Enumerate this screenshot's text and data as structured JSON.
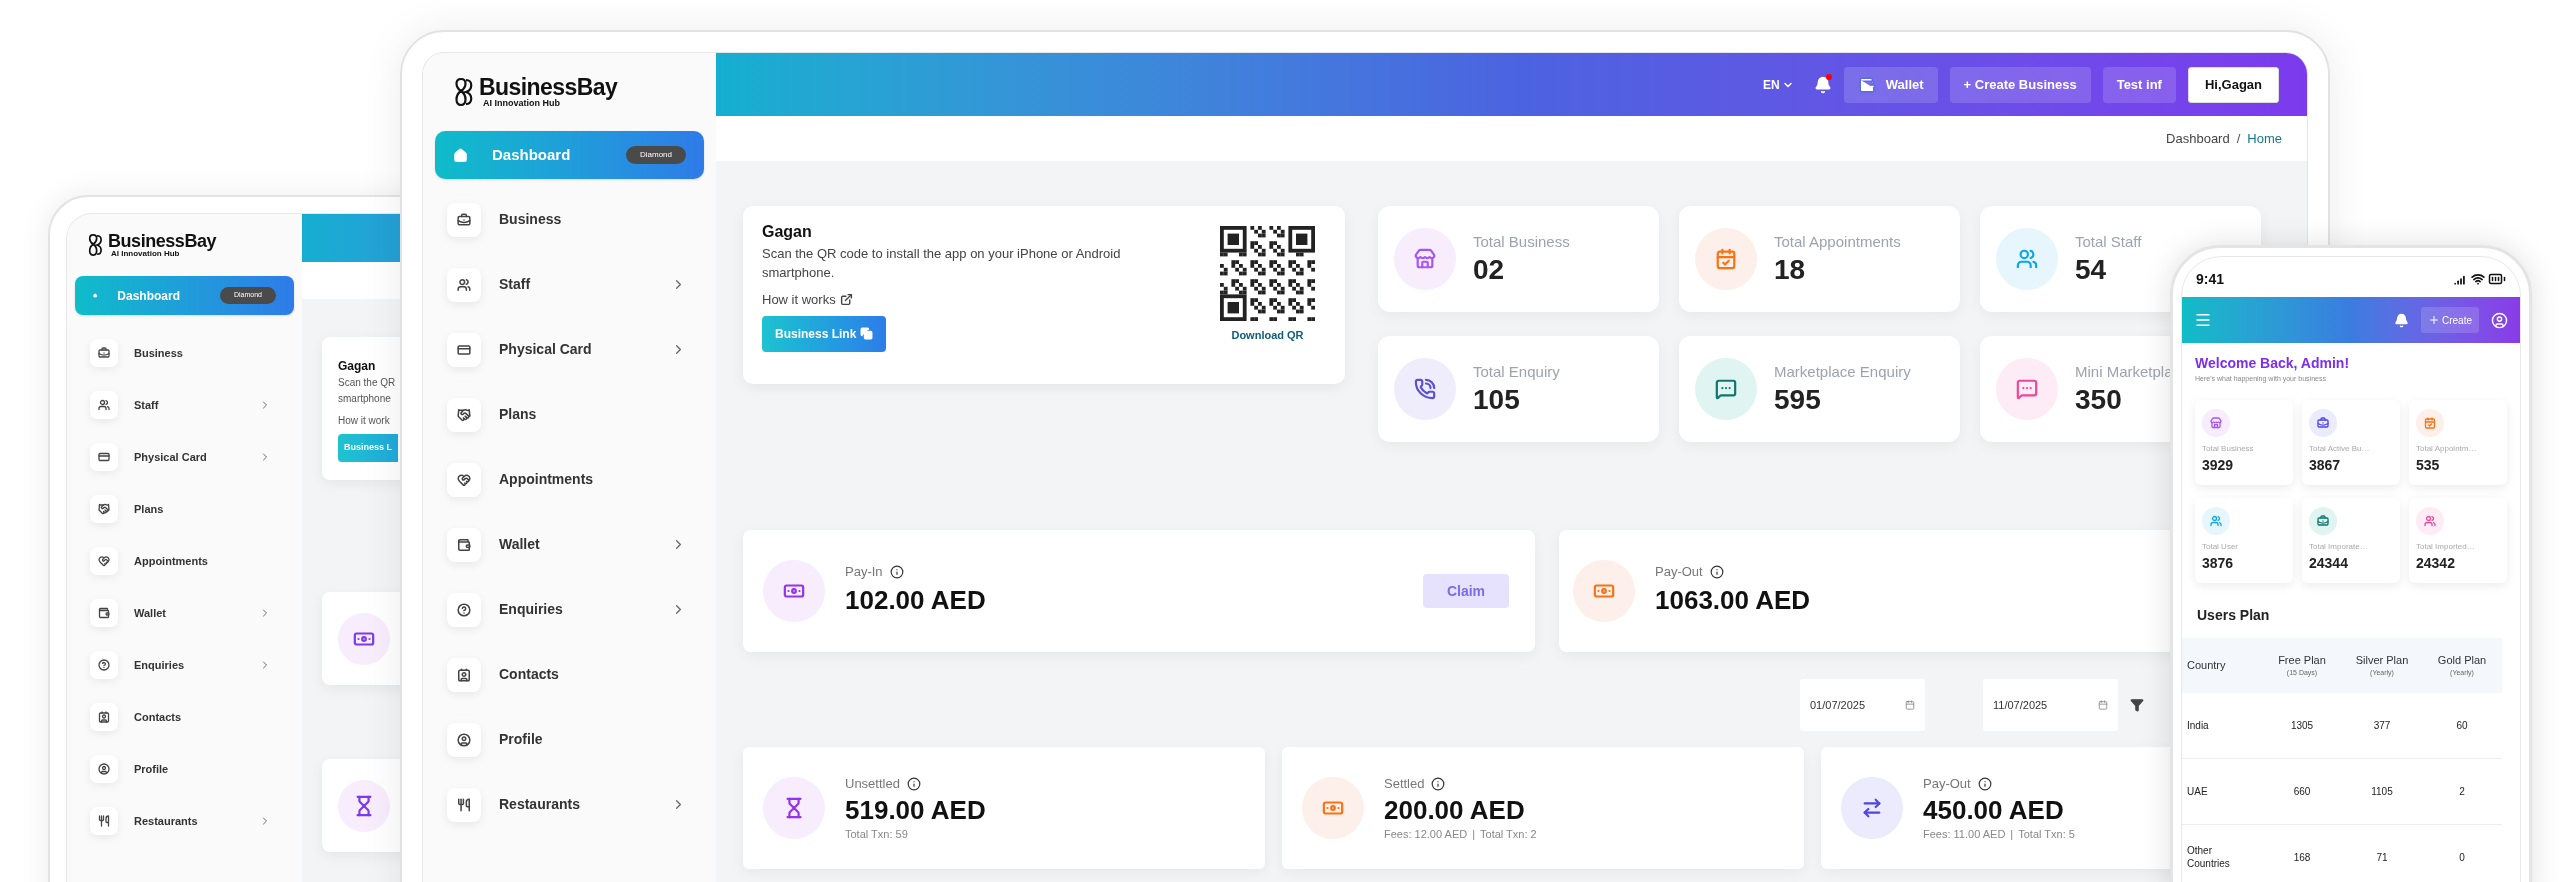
{
  "tablet": {
    "logo": {
      "name": "BusinessBay",
      "tagline": "AI Innovation Hub"
    },
    "nav": [
      {
        "label": "Dashboard",
        "badge": "Diamond",
        "selected": true,
        "submenu": false
      },
      {
        "label": "Business",
        "selected": false,
        "submenu": false
      },
      {
        "label": "Staff",
        "selected": false,
        "submenu": true
      },
      {
        "label": "Physical Card",
        "selected": false,
        "submenu": true
      },
      {
        "label": "Plans",
        "selected": false,
        "submenu": false
      },
      {
        "label": "Appointments",
        "selected": false,
        "submenu": false
      },
      {
        "label": "Wallet",
        "selected": false,
        "submenu": true
      },
      {
        "label": "Enquiries",
        "selected": false,
        "submenu": true
      },
      {
        "label": "Contacts",
        "selected": false,
        "submenu": false
      },
      {
        "label": "Profile",
        "selected": false,
        "submenu": false
      },
      {
        "label": "Restaurants",
        "selected": false,
        "submenu": true
      }
    ],
    "qr_card": {
      "name": "Gagan",
      "description_lines": [
        "Scan the QR",
        "smartphone"
      ],
      "how_it_works": "How it work",
      "button": "Business L"
    }
  },
  "main": {
    "logo": {
      "name": "BusinessBay",
      "tagline": "AI Innovation Hub"
    },
    "nav": [
      {
        "label": "Dashboard",
        "badge": "Diamond",
        "selected": true,
        "submenu": false
      },
      {
        "label": "Business",
        "selected": false,
        "submenu": false
      },
      {
        "label": "Staff",
        "selected": false,
        "submenu": true
      },
      {
        "label": "Physical Card",
        "selected": false,
        "submenu": true
      },
      {
        "label": "Plans",
        "selected": false,
        "submenu": false
      },
      {
        "label": "Appointments",
        "selected": false,
        "submenu": false
      },
      {
        "label": "Wallet",
        "selected": false,
        "submenu": true
      },
      {
        "label": "Enquiries",
        "selected": false,
        "submenu": true
      },
      {
        "label": "Contacts",
        "selected": false,
        "submenu": false
      },
      {
        "label": "Profile",
        "selected": false,
        "submenu": false
      },
      {
        "label": "Restaurants",
        "selected": false,
        "submenu": true
      }
    ],
    "header": {
      "language": "EN",
      "notifications_unread": true,
      "buttons": [
        {
          "label": "Wallet",
          "kind": "wallet"
        },
        {
          "label": "+ Create Business",
          "kind": "plain"
        },
        {
          "label": "Test inf",
          "kind": "plain"
        },
        {
          "label": "Hi,Gagan",
          "kind": "light"
        }
      ]
    },
    "breadcrumb": {
      "items": [
        "Dashboard",
        "Home"
      ],
      "separator": "/"
    },
    "qr_card": {
      "name": "Gagan",
      "description": "Scan the QR code to install the app on your iPhone or Android smartphone.",
      "how_it_works": "How it works",
      "button": "Business Link",
      "download": "Download QR"
    },
    "stats": [
      {
        "label": "Total Business",
        "value": "02"
      },
      {
        "label": "Total Appointments",
        "value": "18"
      },
      {
        "label": "Total Staff",
        "value": "54"
      },
      {
        "label": "Total Enquiry",
        "value": "105"
      },
      {
        "label": "Marketplace Enquiry",
        "value": "595"
      },
      {
        "label": "Mini Marketpla",
        "value": "350"
      }
    ],
    "pay_cards": [
      {
        "label": "Pay-In",
        "amount": "102.00 AED",
        "claim": {
          "label": "Claim",
          "disabled": true
        }
      },
      {
        "label": "Pay-Out",
        "amount": "1063.00 AED"
      }
    ],
    "dates": [
      "01/07/2025",
      "11/07/2025"
    ],
    "summary_cards": [
      {
        "label": "Unsettled",
        "amount": "519.00 AED",
        "details": [
          "Total Txn: 59"
        ]
      },
      {
        "label": "Settled",
        "amount": "200.00 AED",
        "details": [
          "Fees: 12.00 AED",
          "Total Txn: 2"
        ]
      },
      {
        "label": "Pay-Out",
        "amount": "450.00 AED",
        "details": [
          "Fees: 11.00 AED",
          "Total Txn: 5"
        ]
      }
    ],
    "detail_separator": "|"
  },
  "phone": {
    "time": "9:41",
    "create_button": "Create",
    "welcome": "Welcome Back, Admin!",
    "subtitle": "Here's what happening with your business",
    "stats": [
      {
        "label": "Total Business",
        "value": "3929"
      },
      {
        "label": "Total Active Bu…",
        "value": "3867"
      },
      {
        "label": "Total Appointm…",
        "value": "535"
      },
      {
        "label": "Total User",
        "value": "3876"
      },
      {
        "label": "Total Imporate…",
        "value": "24344"
      },
      {
        "label": "Total Imported…",
        "value": "24342"
      }
    ],
    "plan_title": "Users Plan",
    "table": {
      "columns": [
        {
          "title": "Country"
        },
        {
          "title": "Free Plan",
          "note": "(15 Days)"
        },
        {
          "title": "Silver Plan",
          "note": "(Yearly)"
        },
        {
          "title": "Gold Plan",
          "note": "(Yearly)"
        }
      ],
      "rows": [
        [
          "India",
          "1305",
          "377",
          "60"
        ],
        [
          "UAE",
          "660",
          "1105",
          "2"
        ],
        [
          "Other Countries",
          "168",
          "71",
          "0"
        ]
      ]
    }
  }
}
